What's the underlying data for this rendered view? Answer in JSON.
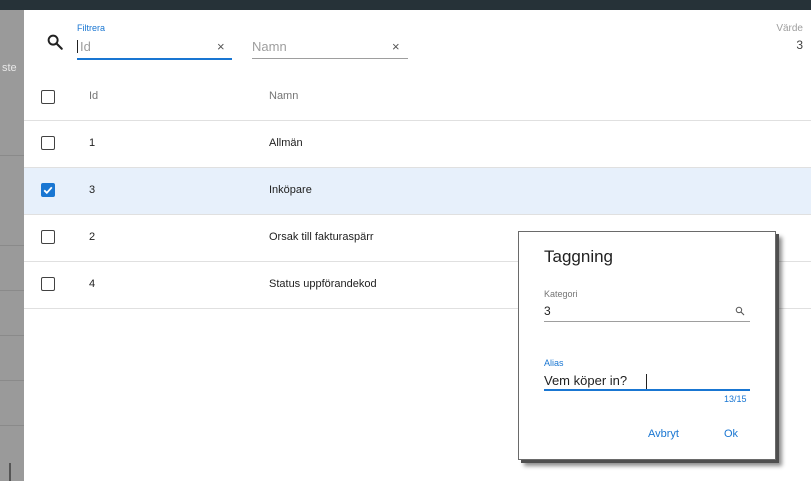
{
  "background_fragment": "ste",
  "filter": {
    "label": "Filtrera",
    "id_placeholder": "Id",
    "namn_placeholder": "Namn",
    "clear_glyph": "×",
    "search_icon": "search-icon"
  },
  "value": {
    "label": "Värde",
    "current": "3"
  },
  "table": {
    "columns": [
      "Id",
      "Namn"
    ],
    "rows": [
      {
        "id": "1",
        "namn": "Allmän",
        "checked": false
      },
      {
        "id": "3",
        "namn": "Inköpare",
        "checked": true
      },
      {
        "id": "2",
        "namn": "Orsak till fakturaspärr",
        "checked": false
      },
      {
        "id": "4",
        "namn": "Status uppförandekod",
        "checked": false
      }
    ]
  },
  "dialog": {
    "title": "Taggning",
    "kategori_label": "Kategori",
    "kategori_value": "3",
    "alias_label": "Alias",
    "alias_value": "Vem köper in?",
    "counter": "13/15",
    "cancel_label": "Avbryt",
    "ok_label": "Ok"
  },
  "colors": {
    "accent": "#1976d2",
    "selected_row": "#e7f0fb",
    "topbar": "#263238"
  }
}
